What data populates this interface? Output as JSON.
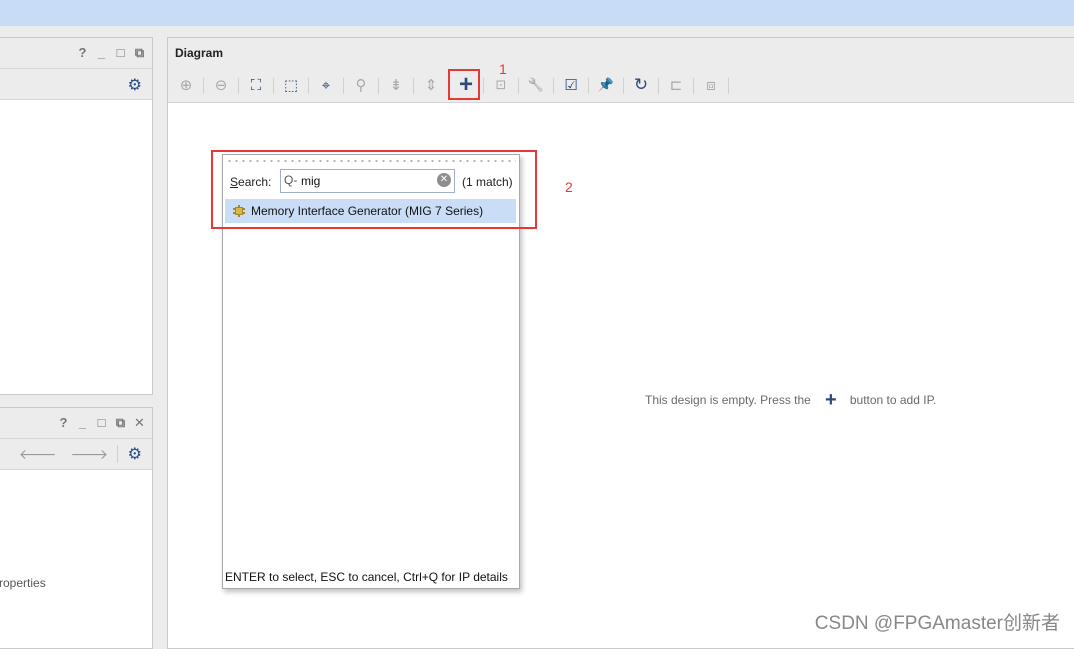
{
  "diagram": {
    "title": "Diagram",
    "empty_message_before": "This design is empty. Press the",
    "empty_message_after": "button to add IP."
  },
  "toolbar": {
    "buttons": [
      {
        "name": "zoom-in-icon",
        "glyph": "⊕"
      },
      {
        "name": "zoom-out-icon",
        "glyph": "⊖"
      },
      {
        "name": "zoom-fit-icon",
        "glyph": "⛶"
      },
      {
        "name": "zoom-area-icon",
        "glyph": "⬚"
      },
      {
        "name": "auto-fit-selection-icon",
        "glyph": "⌖"
      },
      {
        "name": "search-icon",
        "glyph": "⚲"
      },
      {
        "name": "collapse-all-icon",
        "glyph": "⇟"
      },
      {
        "name": "expand-all-icon",
        "glyph": "⇕"
      },
      {
        "name": "add-ip-icon",
        "glyph": "+"
      },
      {
        "name": "add-module-icon",
        "glyph": "⊡"
      },
      {
        "name": "wrench-icon",
        "glyph": "🔧"
      },
      {
        "name": "validate-design-icon",
        "glyph": "☑"
      },
      {
        "name": "pin-icon",
        "glyph": "📌"
      },
      {
        "name": "regenerate-layout-icon",
        "glyph": "↻"
      },
      {
        "name": "run-connection-icon",
        "glyph": "⊏"
      },
      {
        "name": "run-block-automation-icon",
        "glyph": "⧈"
      }
    ]
  },
  "annotations": {
    "box1_label": "1",
    "box2_label": "2"
  },
  "ip_search": {
    "label": "Search:",
    "label_underlined": "S",
    "label_rest": "earch:",
    "query": "mig",
    "search_glyph": "Q-",
    "match_count": "(1 match)",
    "results": [
      {
        "label": "Memory Interface Generator (MIG 7 Series)"
      }
    ],
    "footer": "ENTER to select, ESC to cancel, Ctrl+Q for IP details"
  },
  "left_panels": {
    "properties_fragment": "roperties"
  },
  "watermark": "CSDN @FPGAmaster创新者",
  "colors": {
    "accent": "#2c4a7c",
    "highlight_box": "#e53935",
    "selection": "#c9ddf7",
    "title_band": "#c8dcf8"
  }
}
